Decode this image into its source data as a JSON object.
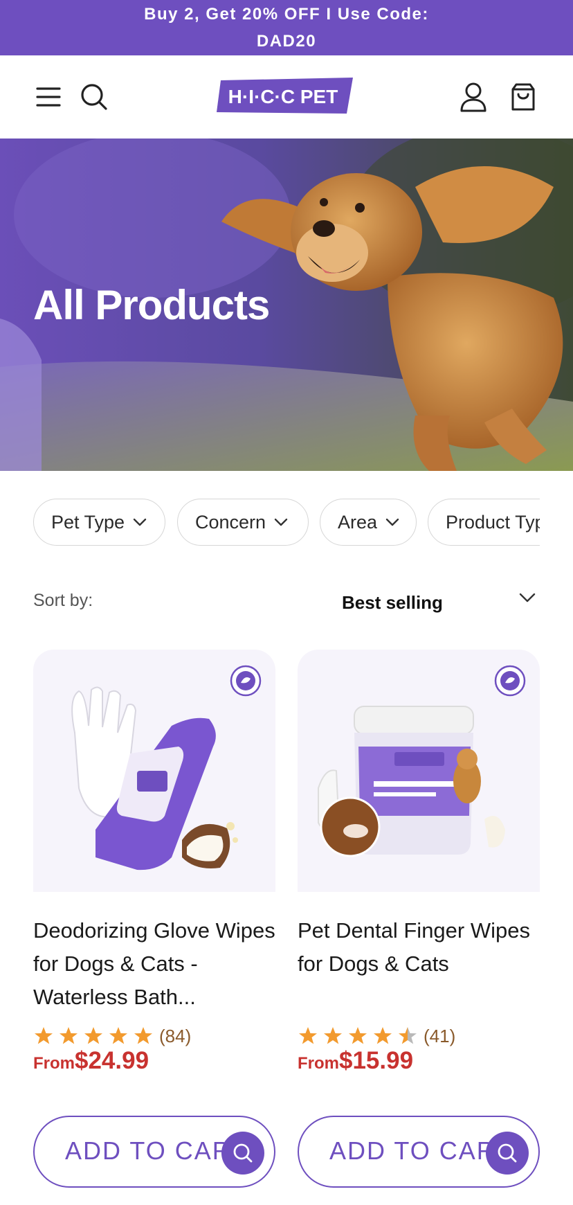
{
  "promo": {
    "line1": "Buy 2, Get 20% OFF I Use Code:",
    "line2": "DAD20"
  },
  "header": {
    "logo_text": "H·I·C·C PET"
  },
  "hero": {
    "title": "All Products"
  },
  "filters": [
    {
      "label": "Pet Type"
    },
    {
      "label": "Concern"
    },
    {
      "label": "Area"
    },
    {
      "label": "Product Type"
    }
  ],
  "sort": {
    "label": "Sort by:",
    "value": "Best selling"
  },
  "products": [
    {
      "title": "Deodorizing Glove Wipes for Dogs & Cats - Waterless Bath...",
      "rating": 5,
      "review_count": "(84)",
      "price_prefix": "From",
      "price": "$24.99",
      "button": "ADD TO CART"
    },
    {
      "title": "Pet Dental Finger Wipes for Dogs & Cats",
      "rating": 4.5,
      "review_count": "(41)",
      "price_prefix": "From",
      "price": "$15.99",
      "button": "ADD TO CART"
    }
  ],
  "colors": {
    "brand_purple": "#6e4fbf",
    "price_red": "#c8322f",
    "star_orange": "#f29a2e"
  }
}
